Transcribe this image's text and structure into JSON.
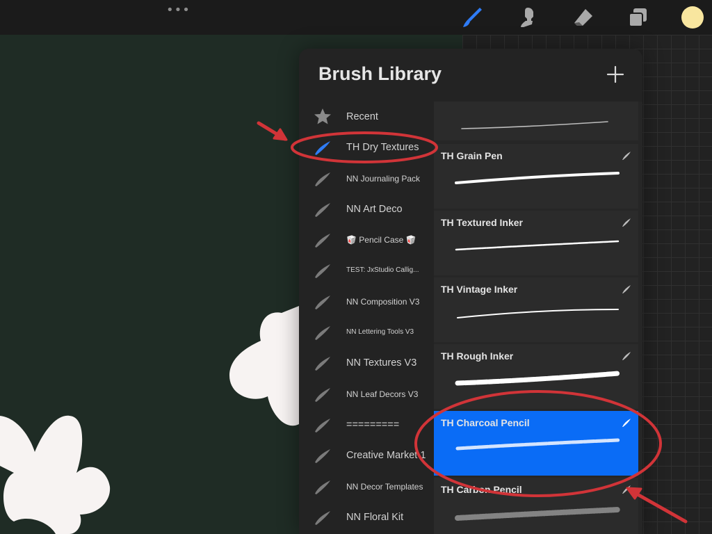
{
  "toolbar": {
    "more_label": "•••",
    "tools": [
      "brush-tool",
      "smudge-tool",
      "eraser-tool",
      "layers-tool"
    ],
    "active_tool": "brush-tool",
    "current_color": "#f8e69f"
  },
  "brush_library": {
    "title": "Brush Library",
    "add_label": "+",
    "sets": [
      {
        "label": "Recent",
        "icon": "star-icon",
        "selected": false
      },
      {
        "label": "TH Dry Textures",
        "icon": "brush-set-icon",
        "selected": true
      },
      {
        "label": "NN Journaling Pack",
        "icon": "brush-set-icon",
        "selected": false
      },
      {
        "label": "NN Art Deco",
        "icon": "brush-set-icon",
        "selected": false
      },
      {
        "label": "🥡 Pencil Case 🥡",
        "icon": "brush-set-icon",
        "selected": false
      },
      {
        "label": "TEST: JxStudio Callig...",
        "icon": "brush-set-icon",
        "selected": false
      },
      {
        "label": "NN Composition V3",
        "icon": "brush-set-icon",
        "selected": false
      },
      {
        "label": "NN Lettering Tools V3",
        "icon": "brush-set-icon",
        "selected": false
      },
      {
        "label": "NN Textures V3",
        "icon": "brush-set-icon",
        "selected": false
      },
      {
        "label": "NN Leaf Decors V3",
        "icon": "brush-set-icon",
        "selected": false
      },
      {
        "label": "=========",
        "icon": "brush-set-icon",
        "selected": false
      },
      {
        "label": "Creative Market 1",
        "icon": "brush-set-icon",
        "selected": false
      },
      {
        "label": "NN Decor Templates",
        "icon": "brush-set-icon",
        "selected": false
      },
      {
        "label": "NN Floral Kit",
        "icon": "brush-set-icon",
        "selected": false
      }
    ],
    "brushes": [
      {
        "name": "",
        "style": "fine"
      },
      {
        "name": "TH Grain Pen",
        "style": "pen"
      },
      {
        "name": "TH Textured Inker",
        "style": "textured"
      },
      {
        "name": "TH Vintage Inker",
        "style": "vintage"
      },
      {
        "name": "TH Rough Inker",
        "style": "rough"
      },
      {
        "name": "TH Charcoal Pencil",
        "style": "charcoal",
        "selected": true
      },
      {
        "name": "TH Carbon Pencil",
        "style": "carbon"
      }
    ]
  },
  "colors": {
    "accent": "#0a6cf6",
    "annotation": "#d13438"
  }
}
